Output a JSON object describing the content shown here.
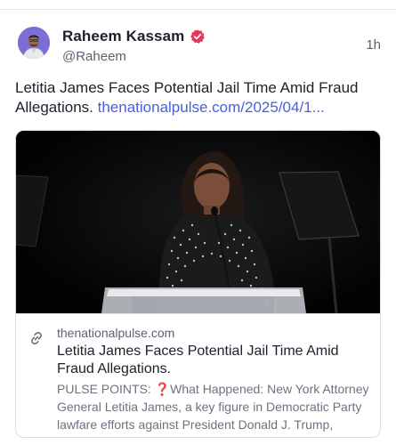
{
  "post": {
    "author_name": "Raheem Kassam",
    "handle": "@Raheem",
    "timestamp": "1h",
    "text": "Letitia James Faces Potential Jail Time Amid Fraud Allegations.",
    "link_text": "thenationalpulse.com/2025/04/1..."
  },
  "card": {
    "domain": "thenationalpulse.com",
    "title": "Letitia James Faces Potential Jail Time Amid Fraud Allegations.",
    "description": "PULSE POINTS: ❓What Happened: New York Attorney General Letitia James, a key figure in Democratic Party lawfare efforts against President Donald J. Trump,"
  },
  "colors": {
    "link": "#4a5ee0",
    "verified_badge": "#e8355c",
    "avatar_bg": "#7b6fd6",
    "text_primary": "#1d1f2b",
    "text_secondary": "#5b6270"
  },
  "icons": {
    "verified": "verified-badge-icon",
    "link": "link-chain-icon"
  }
}
